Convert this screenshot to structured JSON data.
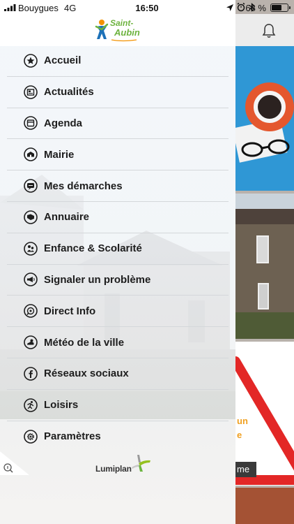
{
  "status_bar": {
    "carrier": "Bouygues",
    "network": "4G",
    "time": "16:50",
    "battery_label": "68 %",
    "battery_level": 0.68
  },
  "header": {
    "logo_text_line1": "Saint-",
    "logo_text_line2": "Aubin",
    "notification_icon": "bell-icon"
  },
  "menu": {
    "items": [
      {
        "label": "Accueil",
        "icon": "star-icon"
      },
      {
        "label": "Actualités",
        "icon": "newspaper-icon"
      },
      {
        "label": "Agenda",
        "icon": "calendar-icon"
      },
      {
        "label": "Mairie",
        "icon": "town-hall-icon"
      },
      {
        "label": "Mes démarches",
        "icon": "chat-bubble-icon"
      },
      {
        "label": "Annuaire",
        "icon": "book-icon"
      },
      {
        "label": "Enfance & Scolarité",
        "icon": "children-icon"
      },
      {
        "label": "Signaler un problème",
        "icon": "megaphone-icon"
      },
      {
        "label": "Direct Info",
        "icon": "live-info-icon"
      },
      {
        "label": "Météo de la ville",
        "icon": "weather-icon"
      },
      {
        "label": "Réseaux sociaux",
        "icon": "facebook-icon"
      },
      {
        "label": "Loisirs",
        "icon": "runner-icon"
      },
      {
        "label": "Paramètres",
        "icon": "gear-icon"
      }
    ]
  },
  "footer": {
    "brand": "Lumiplan"
  },
  "background_cards": {
    "card3_line1": "un",
    "card3_line2": "e",
    "card3_tag": "me"
  },
  "colors": {
    "menu_text": "#1d1d1d",
    "separator": "#d4d7da",
    "logo_green": "#6db33f",
    "logo_orange": "#f39200",
    "logo_blue": "#1d71b8"
  }
}
